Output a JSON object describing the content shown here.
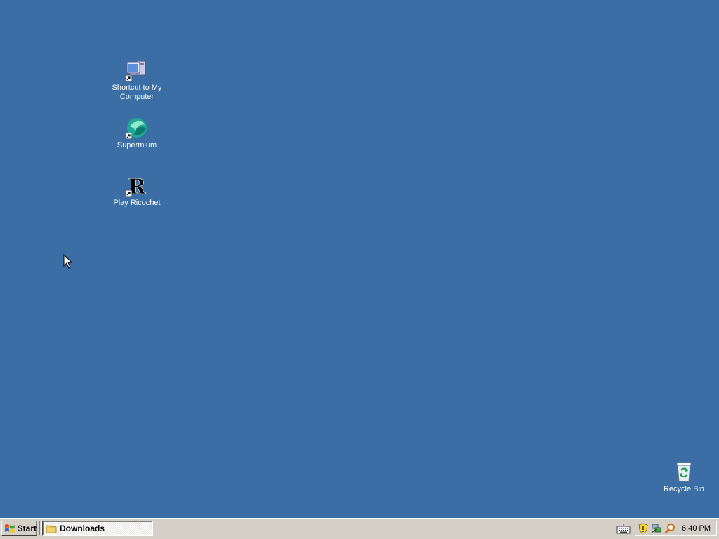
{
  "desktop": {
    "background_color": "#3a6ea5",
    "icons": [
      {
        "label": "Shortcut to My Computer",
        "icon": "my-computer-icon"
      },
      {
        "label": "Supermium",
        "icon": "supermium-icon"
      },
      {
        "label": "Play Ricochet",
        "icon": "ricochet-icon"
      },
      {
        "label": "Recycle Bin",
        "icon": "recycle-bin-icon"
      }
    ]
  },
  "taskbar": {
    "start_label": "Start",
    "tasks": [
      {
        "label": "Downloads",
        "icon": "folder-icon",
        "active": true
      }
    ],
    "tray": {
      "icons": [
        "keyboard-icon",
        "shield-icon",
        "network-icon",
        "search-icon"
      ],
      "clock": "6:40 PM"
    }
  }
}
